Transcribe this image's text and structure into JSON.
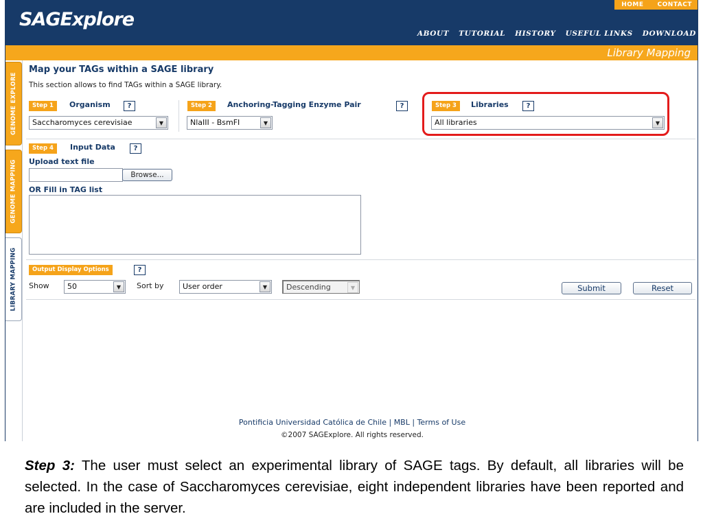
{
  "header": {
    "logo": "SAGExplore",
    "top_links": [
      "HOME",
      "CONTACT"
    ],
    "nav": [
      "ABOUT",
      "TUTORIAL",
      "HISTORY",
      "USEFUL LINKS",
      "DOWNLOAD"
    ],
    "section_title": "Library Mapping"
  },
  "side_tabs": [
    "GENOME EXPLORE",
    "GENOME MAPPING",
    "LIBRARY MAPPING"
  ],
  "main": {
    "title": "Map your TAGs within a SAGE library",
    "description": "This section allows to find TAGs within a SAGE library.",
    "step1": {
      "badge": "Step 1",
      "label": "Organism",
      "help": "?",
      "value": "Saccharomyces cerevisiae"
    },
    "step2": {
      "badge": "Step 2",
      "label": "Anchoring-Tagging Enzyme Pair",
      "help": "?",
      "value": "NlaIII - BsmFI"
    },
    "step3": {
      "badge": "Step 3",
      "label": "Libraries",
      "help": "?",
      "value": "All libraries"
    },
    "step4": {
      "badge": "Step 4",
      "label": "Input Data",
      "help": "?",
      "upload_label": "Upload text file",
      "browse_label": "Browse...",
      "fill_label": "OR Fill in TAG list"
    },
    "output": {
      "badge": "Output Display Options",
      "help": "?",
      "show_label": "Show",
      "show_value": "50",
      "sort_label": "Sort by",
      "sort_value": "User order",
      "order_value": "Descending",
      "submit_label": "Submit",
      "reset_label": "Reset"
    }
  },
  "footer": {
    "links": [
      "Pontificia Universidad Católica de Chile",
      "MBL",
      "Terms of Use"
    ],
    "separator": "|",
    "copyright": "©2007 SAGExplore. All rights reserved."
  },
  "caption": {
    "lead": "Step 3:",
    "text": " The user must select an experimental library of SAGE tags. By default, all libraries will be selected. In the case of Saccharomyces cerevisiae, eight independent libraries have been reported and are included in the server."
  },
  "colors": {
    "header": "#173a68",
    "accent": "#f5a31a",
    "highlight": "#e31b1b"
  }
}
